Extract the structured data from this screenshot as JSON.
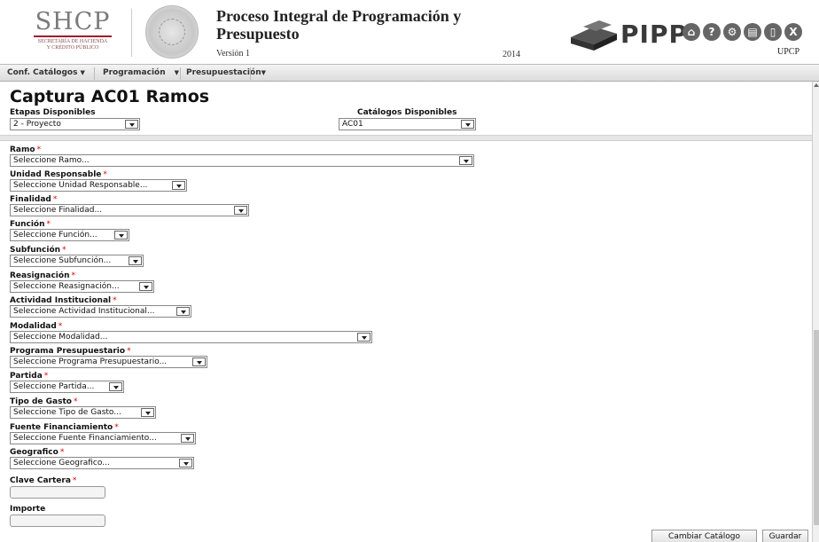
{
  "header": {
    "org_short": "SHCP",
    "org_line1": "Secretaría de Hacienda",
    "org_line2": "y Crédito Público",
    "app_title": "Proceso Integral de Programación y Presupuesto",
    "version": "Versión 1",
    "year": "2014",
    "logo_text": "PIPP",
    "user": "UPCP",
    "icons": [
      "home-icon",
      "help-icon",
      "gear-icon",
      "calculator-icon",
      "document-icon",
      "close-icon"
    ]
  },
  "menubar": {
    "items": [
      {
        "label": "Conf. Catálogos"
      },
      {
        "label": "Programación"
      },
      {
        "label": "Presupuestación"
      }
    ]
  },
  "page": {
    "title": "Captura AC01 Ramos",
    "etapas_label": "Etapas Disponibles",
    "etapas_value": "2 - Proyecto",
    "catalogos_label": "Catálogos Disponibles",
    "catalogos_value": "AC01"
  },
  "fields": {
    "ramo": {
      "label": "Ramo",
      "value": "Seleccione Ramo..."
    },
    "unidad": {
      "label": "Unidad Responsable",
      "value": "Seleccione Unidad Responsable..."
    },
    "finalidad": {
      "label": "Finalidad",
      "value": "Seleccione Finalidad..."
    },
    "funcion": {
      "label": "Función",
      "value": "Seleccione Función..."
    },
    "subfuncion": {
      "label": "Subfunción",
      "value": "Seleccione Subfunción..."
    },
    "reasignacion": {
      "label": "Reasignación",
      "value": "Seleccione Reasignación..."
    },
    "actividad": {
      "label": "Actividad Institucional",
      "value": "Seleccione Actividad Institucional..."
    },
    "modalidad": {
      "label": "Modalidad",
      "value": "Seleccione Modalidad..."
    },
    "programa": {
      "label": "Programa Presupuestario",
      "value": "Seleccione Programa Presupuestario..."
    },
    "partida": {
      "label": "Partida",
      "value": "Seleccione Partida..."
    },
    "tipo_gasto": {
      "label": "Tipo de Gasto",
      "value": "Seleccione Tipo de Gasto..."
    },
    "fuente": {
      "label": "Fuente Financiamiento",
      "value": "Seleccione Fuente Financiamiento..."
    },
    "geografico": {
      "label": "Geografico",
      "value": "Seleccione Geografico..."
    },
    "clave_cartera": {
      "label": "Clave Cartera",
      "value": ""
    },
    "importe": {
      "label": "Importe",
      "value": ""
    }
  },
  "required_marker": "*",
  "buttons": {
    "cambiar": "Cambiar Catálogo",
    "guardar": "Guardar"
  }
}
